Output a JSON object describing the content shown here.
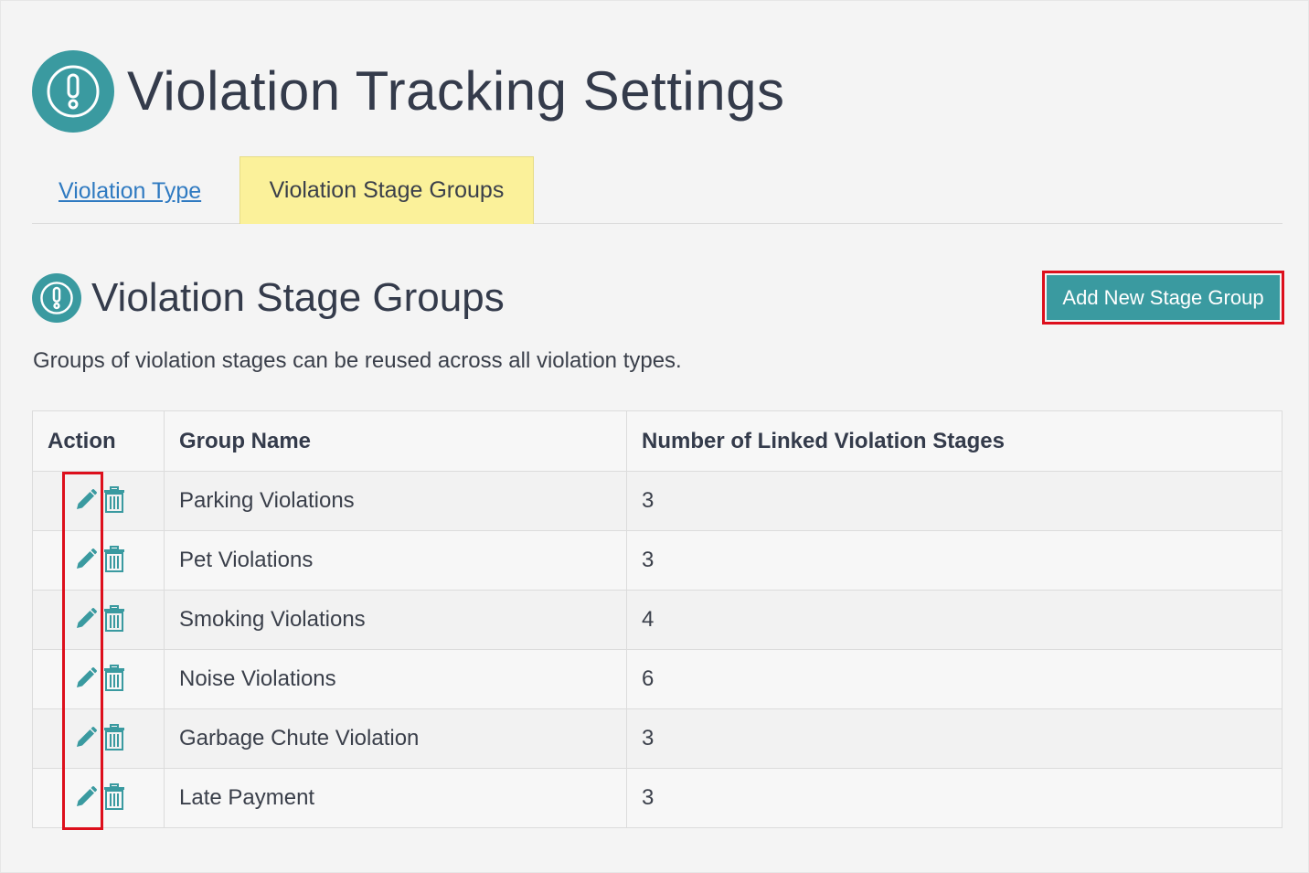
{
  "header": {
    "title": "Violation Tracking Settings",
    "icon": "exclamation-circle-icon"
  },
  "tabs": [
    {
      "label": "Violation Type",
      "active": false
    },
    {
      "label": "Violation Stage Groups",
      "active": true
    }
  ],
  "section": {
    "title": "Violation Stage Groups",
    "icon": "exclamation-circle-icon",
    "description": "Groups of violation stages can be reused across all violation types.",
    "add_button_label": "Add New Stage Group"
  },
  "table": {
    "columns": [
      "Action",
      "Group Name",
      "Number of Linked Violation Stages"
    ],
    "rows": [
      {
        "name": "Parking Violations",
        "count": "3"
      },
      {
        "name": "Pet Violations",
        "count": "3"
      },
      {
        "name": "Smoking Violations",
        "count": "4"
      },
      {
        "name": "Noise Violations",
        "count": "6"
      },
      {
        "name": "Garbage Chute Violation",
        "count": "3"
      },
      {
        "name": "Late Payment",
        "count": "3"
      }
    ],
    "row_action_icons": [
      "pencil-icon",
      "trash-icon"
    ]
  },
  "colors": {
    "accent": "#3a9aa0",
    "active_tab": "#fbf19a",
    "link": "#2f7ac1",
    "highlight": "#dd0f1c"
  }
}
